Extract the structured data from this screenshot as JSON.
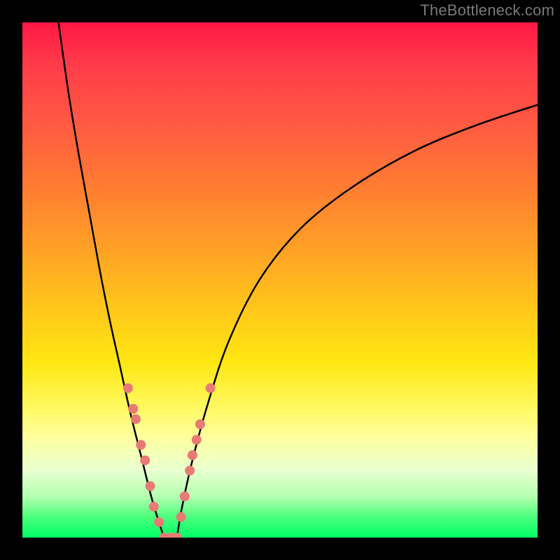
{
  "watermark": "TheBottleneck.com",
  "colors": {
    "curve": "#000000",
    "marker_fill": "#e87a74",
    "marker_stroke": "#d15a54"
  },
  "chart_data": {
    "type": "line",
    "title": "",
    "xlabel": "",
    "ylabel": "",
    "xlim": [
      0,
      100
    ],
    "ylim": [
      0,
      100
    ],
    "grid": false,
    "series": [
      {
        "name": "left-curve",
        "x": [
          7,
          9,
          11,
          13,
          15,
          17,
          19,
          21,
          23,
          25,
          26.5,
          27.5
        ],
        "y": [
          100,
          86,
          74,
          63,
          52,
          42,
          33,
          24,
          16,
          8,
          3,
          0
        ]
      },
      {
        "name": "right-curve",
        "x": [
          30,
          31,
          33,
          36,
          40,
          46,
          54,
          64,
          76,
          88,
          100
        ],
        "y": [
          0,
          6,
          15,
          26,
          38,
          50,
          60,
          68,
          75,
          80,
          84
        ]
      }
    ],
    "markers": [
      {
        "x": 20.5,
        "y": 29
      },
      {
        "x": 21.5,
        "y": 25
      },
      {
        "x": 22.0,
        "y": 23
      },
      {
        "x": 23.0,
        "y": 18
      },
      {
        "x": 23.8,
        "y": 15
      },
      {
        "x": 24.8,
        "y": 10
      },
      {
        "x": 25.5,
        "y": 6
      },
      {
        "x": 26.5,
        "y": 3
      },
      {
        "x": 27.5,
        "y": 0
      },
      {
        "x": 28.8,
        "y": 0
      },
      {
        "x": 30.0,
        "y": 0
      },
      {
        "x": 30.8,
        "y": 4
      },
      {
        "x": 31.5,
        "y": 8
      },
      {
        "x": 32.5,
        "y": 13
      },
      {
        "x": 33.0,
        "y": 16
      },
      {
        "x": 33.8,
        "y": 19
      },
      {
        "x": 34.5,
        "y": 22
      },
      {
        "x": 36.5,
        "y": 29
      }
    ]
  }
}
